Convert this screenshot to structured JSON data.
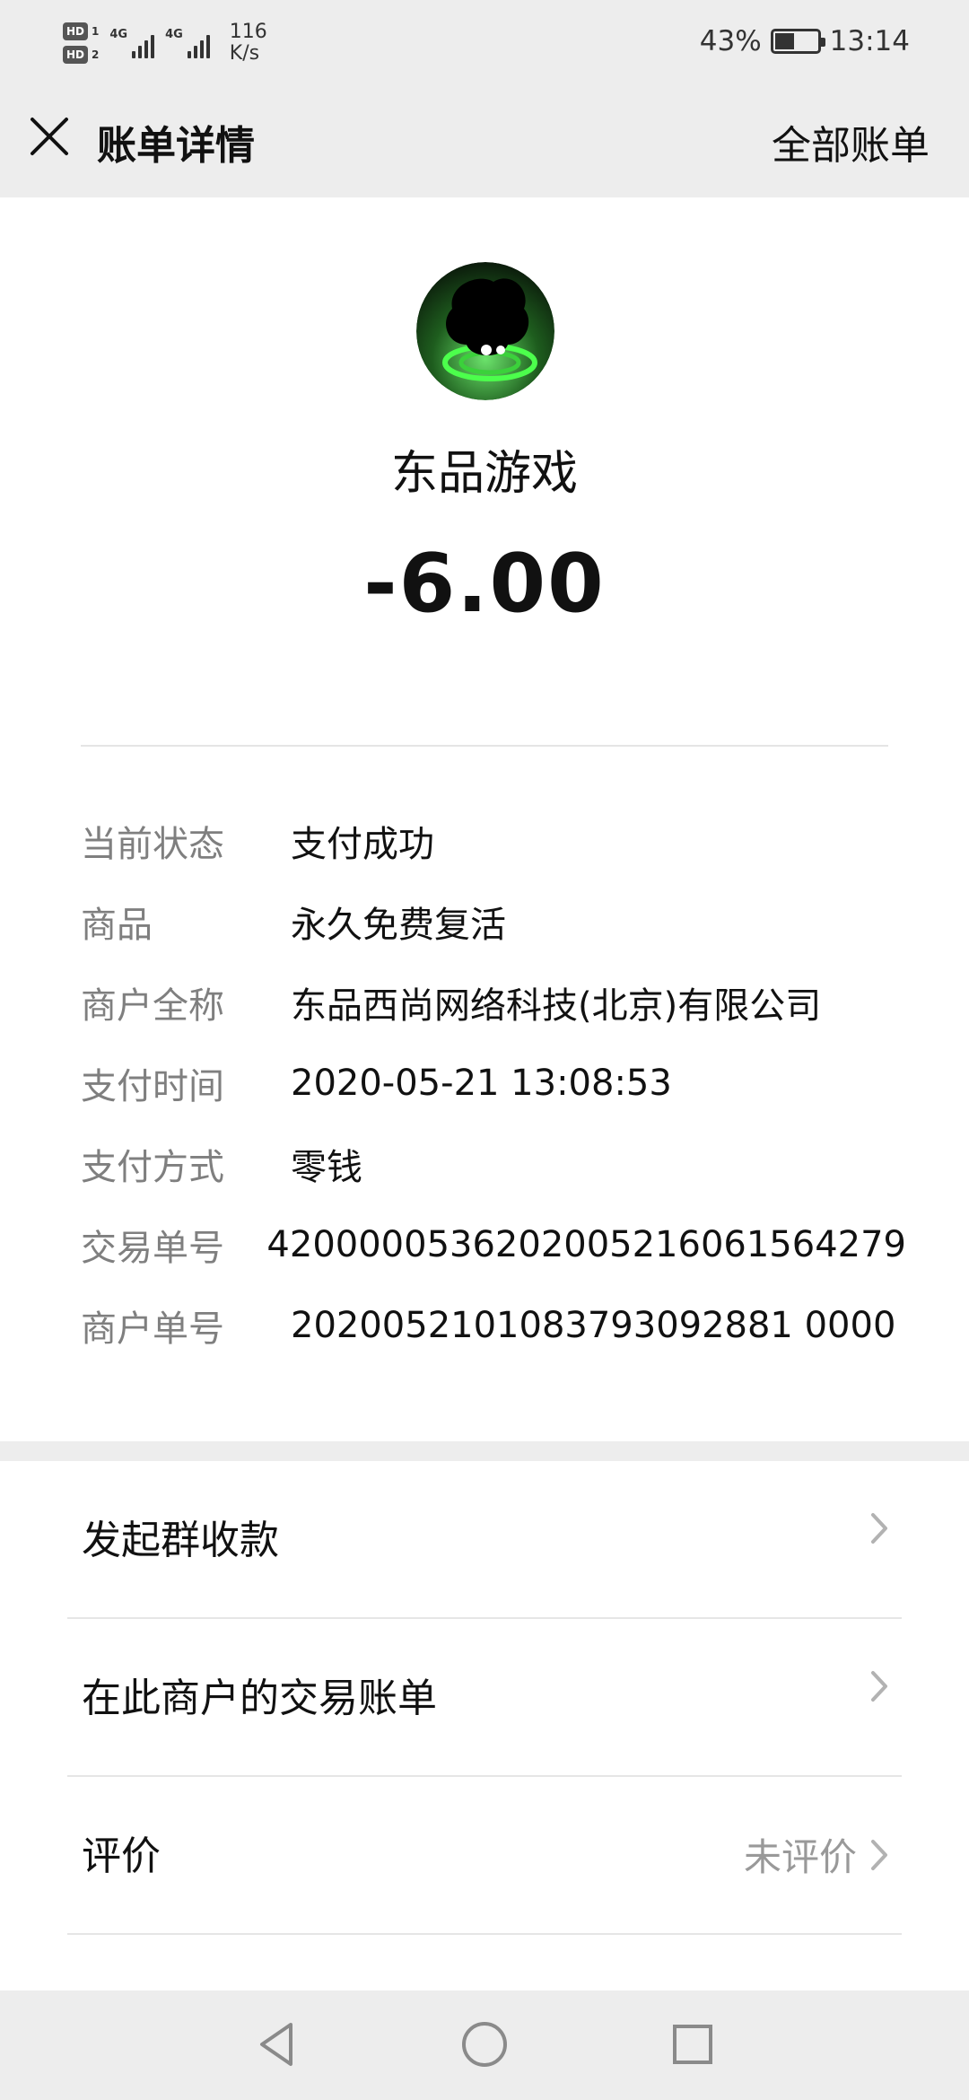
{
  "status_bar": {
    "hd1": "HD",
    "hd1_sub": "1",
    "hd2": "HD",
    "hd2_sub": "2",
    "network1": "4G",
    "network2": "4G",
    "speed_value": "116",
    "speed_unit": "K/s",
    "battery_percent": "43%",
    "time": "13:14"
  },
  "nav": {
    "title": "账单详情",
    "all_bills": "全部账单",
    "close_icon": "close-icon"
  },
  "transaction": {
    "merchant": "东品游戏",
    "amount": "-6.00",
    "details": [
      {
        "label": "当前状态",
        "value": "支付成功"
      },
      {
        "label": "商品",
        "value": "永久免费复活"
      },
      {
        "label": "商户全称",
        "value": "东品西尚网络科技(北京)有限公司"
      },
      {
        "label": "支付时间",
        "value": "2020-05-21 13:08:53"
      },
      {
        "label": "支付方式",
        "value": "零钱"
      },
      {
        "label": "交易单号",
        "value": "4200000536202005216061564279"
      },
      {
        "label": "商户单号",
        "value": "2020052101083793092881 0000"
      }
    ]
  },
  "actions": [
    {
      "label": "发起群收款",
      "note": ""
    },
    {
      "label": "在此商户的交易账单",
      "note": ""
    },
    {
      "label": "评价",
      "note": "未评价"
    }
  ],
  "colors": {
    "background": "#ededed",
    "card": "#ffffff",
    "label_gray": "#7f7f7f",
    "accent_green": "#3bd13b"
  },
  "system_nav": {
    "back": "back-triangle-icon",
    "home": "home-circle-icon",
    "recent": "recent-square-icon"
  }
}
